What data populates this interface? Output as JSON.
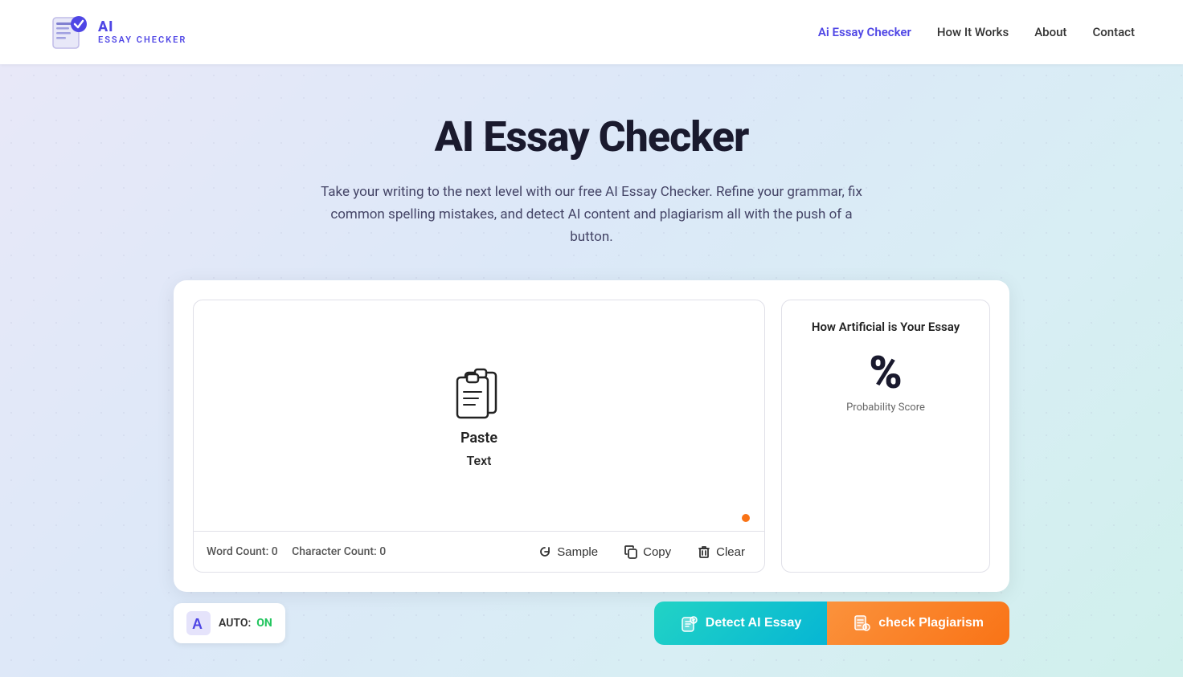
{
  "nav": {
    "logo_ai": "AI",
    "logo_sub": "ESSAY CHECKER",
    "links": [
      {
        "label": "Ai Essay Checker",
        "id": "ai-essay-checker",
        "active": true
      },
      {
        "label": "How It Works",
        "id": "how-it-works",
        "active": false
      },
      {
        "label": "About",
        "id": "about",
        "active": false
      },
      {
        "label": "Contact",
        "id": "contact",
        "active": false
      }
    ]
  },
  "hero": {
    "title": "AI Essay Checker",
    "subtitle": "Take your writing to the next level with our free AI Essay Checker. Refine your grammar, fix common spelling mistakes, and detect AI content and plagiarism all with the push of a button."
  },
  "editor": {
    "paste_label": "Paste",
    "paste_sub": "Text",
    "word_count_label": "Word Count: 0",
    "char_count_label": "Character Count: 0",
    "sample_btn": "Sample",
    "copy_btn": "Copy",
    "clear_btn": "Clear"
  },
  "score": {
    "title": "How Artificial is Your Essay",
    "percent": "%",
    "label": "Probability Score"
  },
  "bottom": {
    "auto_label": "AUTO:",
    "auto_status": "ON",
    "detect_btn": "Detect AI Essay",
    "plagiarism_btn": "check Plagiarism"
  }
}
